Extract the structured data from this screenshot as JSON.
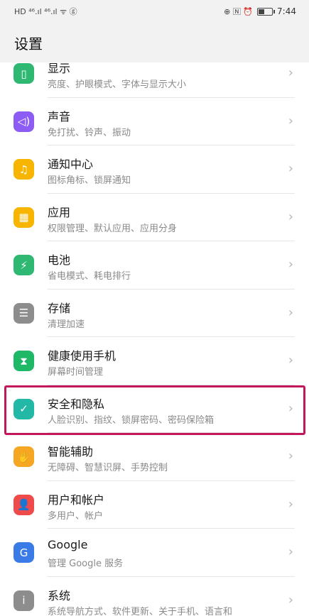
{
  "status_bar": {
    "left_glyphs": "HD ⁴⁶.ıl ⁴⁶.ıl ᯤ ⓖ",
    "right_glyphs": "⊕ 🄽 ⏰",
    "time": "7:44",
    "battery_level": 0.45
  },
  "header": {
    "title": "设置"
  },
  "settings": [
    {
      "title": "显示",
      "subtitle": "亮度、护眼模式、字体与显示大小",
      "icon": "display-icon",
      "icon_glyph": "▯",
      "color": "#2eb872"
    },
    {
      "title": "声音",
      "subtitle": "免打扰、铃声、振动",
      "icon": "sound-icon",
      "icon_glyph": "◁)",
      "color": "#8c5cf5"
    },
    {
      "title": "通知中心",
      "subtitle": "图标角标、锁屏通知",
      "icon": "bell-icon",
      "icon_glyph": "♫",
      "color": "#f7b500"
    },
    {
      "title": "应用",
      "subtitle": "权限管理、默认应用、应用分身",
      "icon": "apps-icon",
      "icon_glyph": "▦",
      "color": "#f7b500"
    },
    {
      "title": "电池",
      "subtitle": "省电模式、耗电排行",
      "icon": "battery-icon",
      "icon_glyph": "⚡",
      "color": "#2eb872"
    },
    {
      "title": "存储",
      "subtitle": "清理加速",
      "icon": "storage-icon",
      "icon_glyph": "☰",
      "color": "#8d8d8d"
    },
    {
      "title": "健康使用手机",
      "subtitle": "屏幕时间管理",
      "icon": "hourglass-icon",
      "icon_glyph": "⧗",
      "color": "#1fb866"
    },
    {
      "title": "安全和隐私",
      "subtitle": "人脸识别、指纹、锁屏密码、密码保险箱",
      "icon": "shield-icon",
      "icon_glyph": "✓",
      "color": "#22b8a6"
    },
    {
      "title": "智能辅助",
      "subtitle": "无障碍、智慧识屏、手势控制",
      "icon": "hand-icon",
      "icon_glyph": "✋",
      "color": "#f5a623"
    },
    {
      "title": "用户和帐户",
      "subtitle": "多用户、帐户",
      "icon": "user-icon",
      "icon_glyph": "👤",
      "color": "#ef4b4b"
    },
    {
      "title": "Google",
      "subtitle": "管理 Google 服务",
      "icon": "google-icon",
      "icon_glyph": "G",
      "color": "#3a7be8"
    },
    {
      "title": "系统",
      "subtitle": "系统导航方式、软件更新、关于手机、语言和",
      "icon": "system-icon",
      "icon_glyph": "i",
      "color": "#8d8d8d"
    }
  ]
}
